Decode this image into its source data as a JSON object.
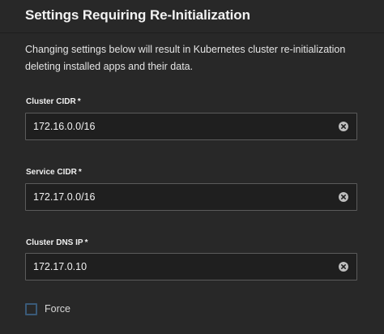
{
  "section": {
    "title": "Settings Requiring Re-Initialization",
    "description": "Changing settings below will result in Kubernetes cluster re-initialization deleting installed apps and their data."
  },
  "fields": {
    "cluster_cidr": {
      "label": "Cluster CIDR",
      "required_mark": "*",
      "value": "172.16.0.0/16"
    },
    "service_cidr": {
      "label": "Service CIDR",
      "required_mark": "*",
      "value": "172.17.0.0/16"
    },
    "cluster_dns_ip": {
      "label": "Cluster DNS IP",
      "required_mark": "*",
      "value": "172.17.0.10"
    }
  },
  "force": {
    "label": "Force",
    "checked": false
  },
  "icons": {
    "clear": "clear-circle-icon"
  },
  "colors": {
    "background": "#282828",
    "input_background": "#1f1f1f",
    "input_border": "#5b5b5b",
    "checkbox_border": "#3a5a78"
  }
}
